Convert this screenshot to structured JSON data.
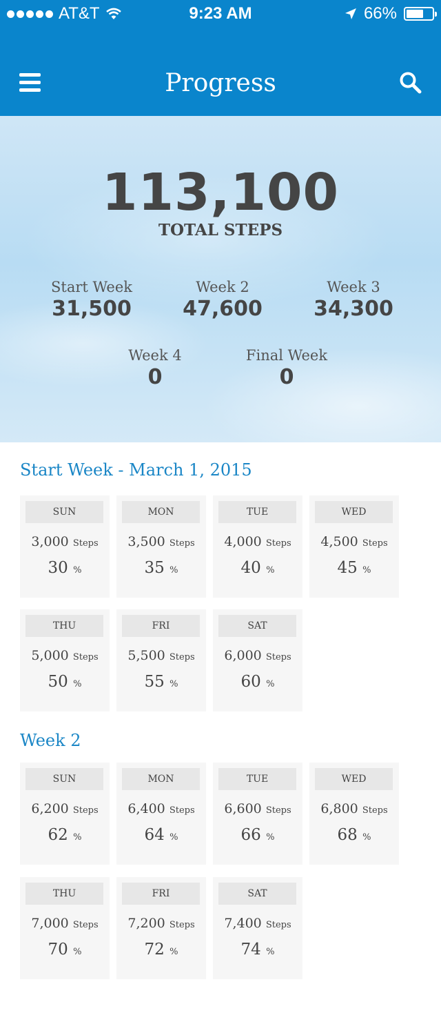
{
  "status_bar": {
    "carrier": "AT&T",
    "time": "9:23 AM",
    "battery": "66%",
    "battery_level": 0.66
  },
  "header": {
    "title": "Progress"
  },
  "summary": {
    "total": "113,100",
    "total_label": "TOTAL STEPS",
    "weeks": [
      {
        "name": "Start Week",
        "value": "31,500"
      },
      {
        "name": "Week 2",
        "value": "47,600"
      },
      {
        "name": "Week 3",
        "value": "34,300"
      },
      {
        "name": "Week 4",
        "value": "0"
      },
      {
        "name": "Final Week",
        "value": "0"
      }
    ]
  },
  "sections": [
    {
      "title": "Start Week - March 1, 2015",
      "days": [
        {
          "day": "SUN",
          "steps": "3,000",
          "pct": "30"
        },
        {
          "day": "MON",
          "steps": "3,500",
          "pct": "35"
        },
        {
          "day": "TUE",
          "steps": "4,000",
          "pct": "40"
        },
        {
          "day": "WED",
          "steps": "4,500",
          "pct": "45"
        },
        {
          "day": "THU",
          "steps": "5,000",
          "pct": "50"
        },
        {
          "day": "FRI",
          "steps": "5,500",
          "pct": "55"
        },
        {
          "day": "SAT",
          "steps": "6,000",
          "pct": "60"
        }
      ]
    },
    {
      "title": "Week 2",
      "days": [
        {
          "day": "SUN",
          "steps": "6,200",
          "pct": "62"
        },
        {
          "day": "MON",
          "steps": "6,400",
          "pct": "64"
        },
        {
          "day": "TUE",
          "steps": "6,600",
          "pct": "66"
        },
        {
          "day": "WED",
          "steps": "6,800",
          "pct": "68"
        },
        {
          "day": "THU",
          "steps": "7,000",
          "pct": "70"
        },
        {
          "day": "FRI",
          "steps": "7,200",
          "pct": "72"
        },
        {
          "day": "SAT",
          "steps": "7,400",
          "pct": "74"
        }
      ]
    }
  ],
  "labels": {
    "steps_unit": "Steps",
    "pct_unit": "%"
  },
  "colors": {
    "header": "#0a85cc",
    "section_title": "#1a86c6",
    "card_bg": "#f6f6f6"
  },
  "icons": {
    "menu": "menu-icon",
    "search": "search-icon",
    "wifi": "wifi-icon",
    "location": "location-arrow-icon",
    "battery": "battery-icon"
  }
}
